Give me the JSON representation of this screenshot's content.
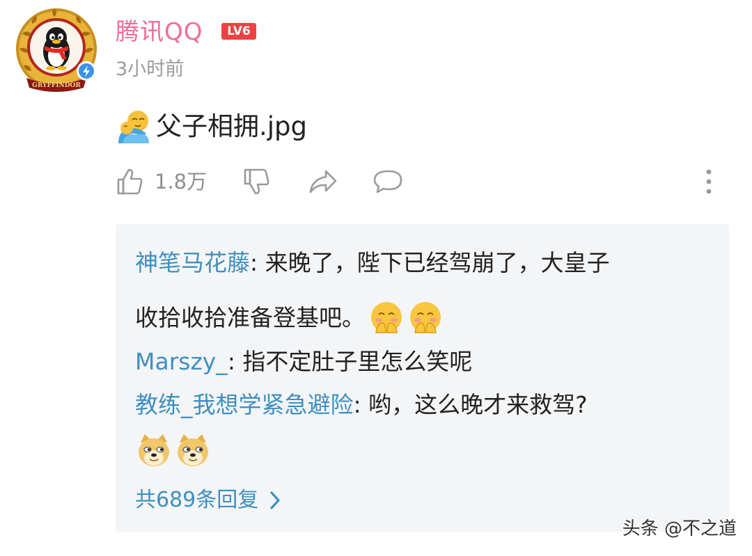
{
  "post": {
    "username": "腾讯QQ",
    "level": "LV6",
    "timestamp": "3小时前",
    "avatar_icon": "qq-penguin-gryffindor-avatar",
    "avatar_text": "GRYFFINDOR",
    "content_emoji": "hug-emoji",
    "content_text": "父子相拥.jpg"
  },
  "actions": {
    "like_count": "1.8万",
    "icons": [
      "thumbs-up-icon",
      "thumbs-down-icon",
      "share-icon",
      "comment-icon",
      "more-icon"
    ]
  },
  "replies": [
    {
      "author": "神笔马花藤",
      "text_line1": ": 来晚了，陛下已经驾崩了，大皇子",
      "text_line2": "收拾收拾准备登基吧。",
      "emojis": [
        "shy-face-emoji",
        "shy-face-emoji"
      ]
    },
    {
      "author": "Marszy_",
      "text_line1": ": 指不定肚子里怎么笑呢"
    },
    {
      "author": "教练_我想学紧急避险",
      "text_line1": ": 哟，这么晚才来救驾?",
      "emojis": [
        "doge-emoji",
        "doge-emoji"
      ]
    }
  ],
  "more_replies": "共689条回复",
  "watermark": "头条 @不之道",
  "colors": {
    "username": "#ef6c96",
    "level_badge": "#ef4141",
    "reply_author": "#3f8fbf",
    "reply_bg": "#f4f5f7",
    "icon_gray": "#9a9a9a"
  }
}
